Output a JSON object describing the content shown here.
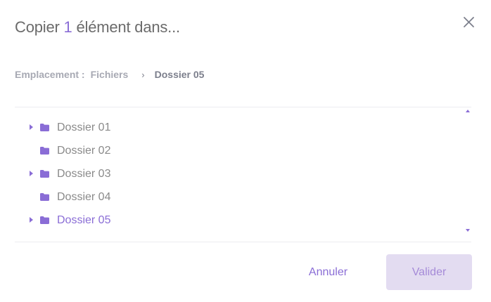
{
  "dialog": {
    "title_prefix": "Copier",
    "title_count": "1",
    "title_suffix": "élément dans..."
  },
  "breadcrumb": {
    "prefix": "Emplacement :",
    "root": "Fichiers",
    "separator": "›",
    "current": "Dossier 05"
  },
  "tree": {
    "items": [
      {
        "label": "Dossier 01",
        "has_children": true,
        "selected": false
      },
      {
        "label": "Dossier 02",
        "has_children": false,
        "selected": false
      },
      {
        "label": "Dossier 03",
        "has_children": true,
        "selected": false
      },
      {
        "label": "Dossier 04",
        "has_children": false,
        "selected": false
      },
      {
        "label": "Dossier 05",
        "has_children": true,
        "selected": true
      }
    ]
  },
  "actions": {
    "cancel_label": "Annuler",
    "validate_label": "Valider"
  },
  "colors": {
    "accent": "#8a6dd6",
    "validate_bg": "#e3dcf1",
    "text_muted": "#8a8a8a"
  },
  "icons": {
    "close": "close-icon",
    "folder": "folder-icon",
    "expand": "caret-right-icon",
    "scroll_up": "scroll-up-icon",
    "scroll_down": "scroll-down-icon"
  }
}
